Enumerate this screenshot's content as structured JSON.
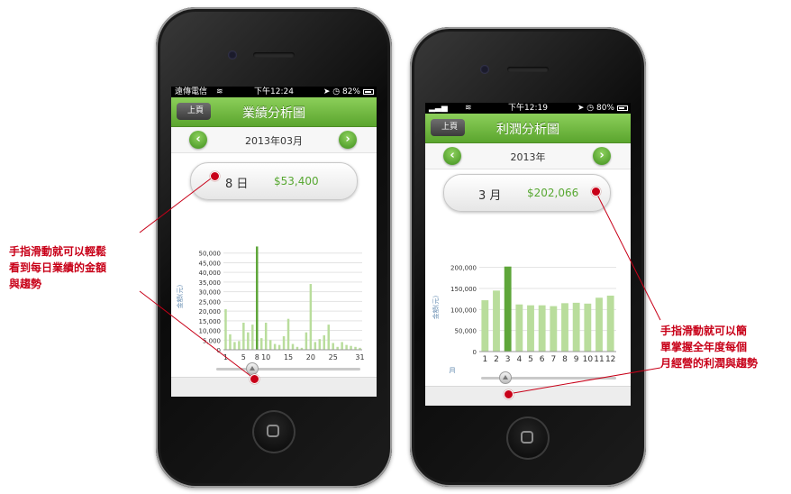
{
  "phone_left": {
    "status": {
      "carrier": "遠傳電信",
      "time": "下午12:24",
      "battery": "82%",
      "battery_level": 0.82
    },
    "nav": {
      "back_label": "上頁",
      "title": "業績分析圖"
    },
    "date": {
      "label": "2013年03月",
      "prev_icon": "chevron-left-icon",
      "next_icon": "chevron-right-icon"
    },
    "selection": {
      "key": "8 日",
      "value": "$53,400"
    },
    "slider": {
      "position": 0.25
    }
  },
  "phone_right": {
    "status": {
      "time": "下午12:19",
      "battery": "80%",
      "battery_level": 0.8
    },
    "nav": {
      "back_label": "上頁",
      "title": "利潤分析圖"
    },
    "date": {
      "label": "2013年",
      "prev_icon": "chevron-left-icon",
      "next_icon": "chevron-right-icon"
    },
    "selection": {
      "key": "3 月",
      "value": "$202,066"
    },
    "slider": {
      "position": 0.18
    }
  },
  "callouts": {
    "left": "手指滑動就可以輕鬆\n看到每日業績的金額\n與趨勢",
    "right": "手指滑動就可以簡\n單掌握全年度每個\n月經營的利潤與趨勢"
  },
  "colors": {
    "accent_green": "#5ba52e",
    "bar_light": "#b9dd9c",
    "bar_dark": "#5ea63a",
    "callout_red": "#c80018"
  },
  "chart_data": [
    {
      "type": "bar",
      "ylabel": "金額(元)",
      "ylim": [
        0,
        55000
      ],
      "yticks": [
        0,
        5000,
        10000,
        15000,
        20000,
        25000,
        30000,
        35000,
        40000,
        45000,
        50000
      ],
      "ytick_labels": [
        "0",
        "5,000",
        "10,000",
        "15,000",
        "20,000",
        "25,000",
        "30,000",
        "35,000",
        "40,000",
        "45,000",
        "50,000"
      ],
      "categories": [
        1,
        2,
        3,
        4,
        5,
        6,
        7,
        8,
        9,
        10,
        11,
        12,
        13,
        14,
        15,
        16,
        17,
        18,
        19,
        20,
        21,
        22,
        23,
        24,
        25,
        26,
        27,
        28,
        29,
        30,
        31
      ],
      "xtick_labels": [
        "1",
        "5",
        "8",
        "10",
        "15",
        "20",
        "25",
        "31"
      ],
      "values": [
        21000,
        8000,
        4000,
        4500,
        14000,
        9000,
        13000,
        53400,
        6000,
        14000,
        5000,
        3000,
        2500,
        7000,
        16000,
        3000,
        1500,
        1000,
        9000,
        34000,
        4000,
        5500,
        7500,
        13000,
        3500,
        1500,
        4000,
        2500,
        2000,
        1500,
        1000
      ],
      "highlight_index": 7,
      "grid": true
    },
    {
      "type": "bar",
      "ylabel": "金額(元)",
      "xlabel": "月",
      "ylim": [
        0,
        210000
      ],
      "yticks": [
        0,
        50000,
        100000,
        150000,
        200000
      ],
      "ytick_labels": [
        "0",
        "50,000",
        "100,000",
        "150,000",
        "200,000"
      ],
      "categories": [
        1,
        2,
        3,
        4,
        5,
        6,
        7,
        8,
        9,
        10,
        11,
        12
      ],
      "xtick_labels": [
        "1",
        "2",
        "3",
        "4",
        "5",
        "6",
        "7",
        "8",
        "9",
        "10",
        "11",
        "12"
      ],
      "values": [
        122000,
        145000,
        202066,
        112000,
        110000,
        110000,
        108000,
        115000,
        116000,
        114000,
        128000,
        133000
      ],
      "highlight_index": 2,
      "grid": true
    }
  ]
}
